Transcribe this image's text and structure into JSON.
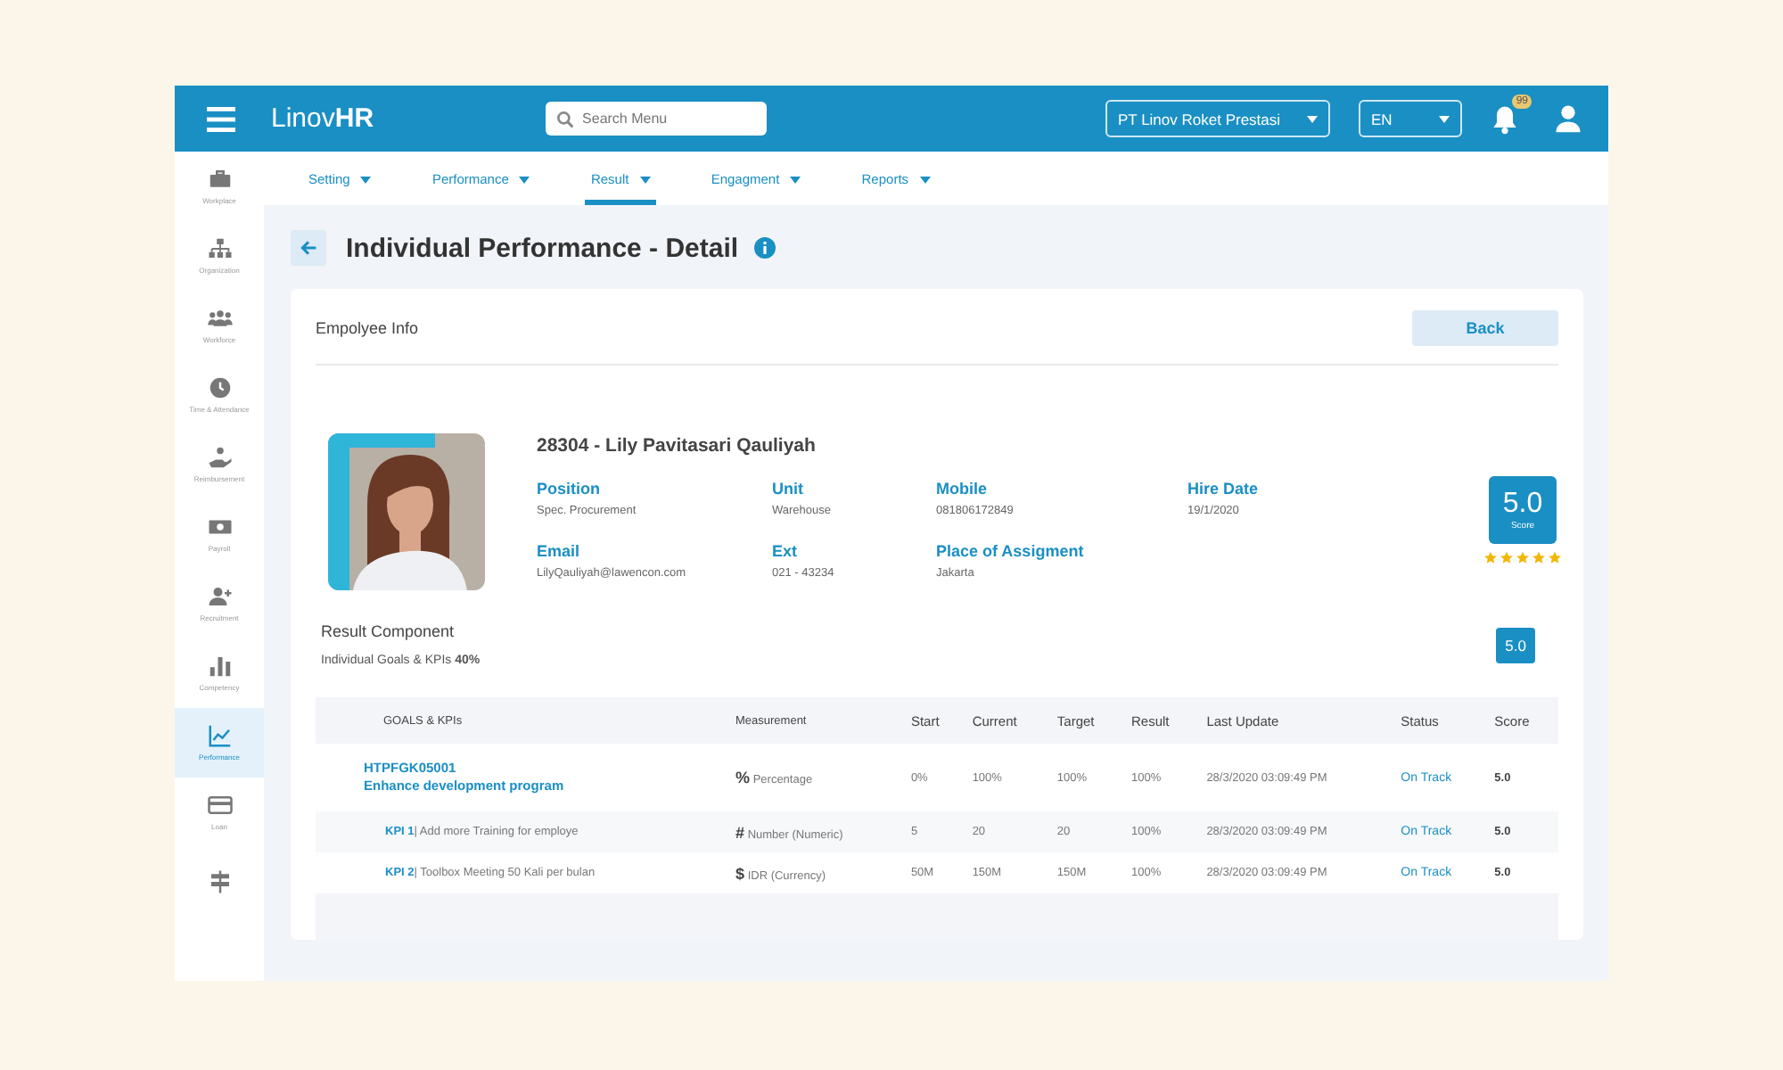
{
  "topbar": {
    "logo": "Linov**HR**",
    "search": {
      "placeholder": "Search Menu"
    },
    "company": "PT Linov Roket Prestasi",
    "language": "EN",
    "notification_count": "99"
  },
  "nav_tabs": [
    {
      "label": "Setting",
      "selected": false
    },
    {
      "label": "Performance",
      "selected": false
    },
    {
      "label": "Result",
      "selected": true
    },
    {
      "label": "Engagment",
      "selected": false
    },
    {
      "label": "Reports",
      "selected": false
    }
  ],
  "sidebar": {
    "items": [
      {
        "label": "Workplace",
        "selected": false
      },
      {
        "label": "Organization",
        "selected": false
      },
      {
        "label": "Workforce",
        "selected": false
      },
      {
        "label": "Time & Attendance",
        "selected": false
      },
      {
        "label": "Reimbursement",
        "selected": false
      },
      {
        "label": "Payroll",
        "selected": false
      },
      {
        "label": "Recruitment",
        "selected": false
      },
      {
        "label": "Competency",
        "selected": false
      },
      {
        "label": "Performance",
        "selected": true
      },
      {
        "label": "Loan",
        "selected": false
      },
      {
        "selected": false
      }
    ]
  },
  "page_title": "Individual Performance - Detail",
  "card": {
    "title": "Empolyee Info",
    "back_button": "Back",
    "employee": {
      "name": "28304 - Lily Pavitasari Qauliyah",
      "fields": [
        {
          "label": "Position",
          "value": "Spec. Procurement"
        },
        {
          "label": "Unit",
          "value": "Warehouse"
        },
        {
          "label": "Mobile",
          "value": "081806172849"
        },
        {
          "label": "Hire Date",
          "value": "19/1/2020"
        },
        {
          "label": "Email",
          "value": "LilyQauliyah@lawencon.com"
        },
        {
          "label": "Ext",
          "value": "021 - 43234"
        },
        {
          "label": "Place of Assigment",
          "value": "Jakarta"
        }
      ],
      "score": "5.0",
      "score_label": "Score",
      "stars": 5
    },
    "result_component": {
      "title": "Result Component",
      "subtitle": "Individual Goals & KPIs **40%**",
      "score": "5.0"
    },
    "table": {
      "columns": [
        "GOALS & KPIs",
        "Measurement",
        "Start",
        "Current",
        "Target",
        "Result",
        "Last Update",
        "Status",
        "Score"
      ],
      "rows": [
        {
          "kind": "goal",
          "code": "HTPFGK05001",
          "name": "Enhance development program",
          "measure_icon": "%",
          "measurement": "Percentage",
          "start": "0%",
          "current": "100%",
          "target": "100%",
          "result": "100%",
          "last_update": "28/3/2020 03:09:49 PM",
          "status": "On Track",
          "score": "5.0"
        },
        {
          "kind": "kpi",
          "code": "KPI 1",
          "name": "| Add more Training for employe",
          "measure_icon": "#",
          "measurement": "Number (Numeric)",
          "start": "5",
          "current": "20",
          "target": "20",
          "result": "100%",
          "last_update": "28/3/2020 03:09:49 PM",
          "status": "On Track",
          "score": "5.0"
        },
        {
          "kind": "kpi",
          "code": "KPI 2",
          "name": "| Toolbox Meeting 50 Kali per bulan",
          "measure_icon": "$",
          "measurement": "IDR (Currency)",
          "start": "50M",
          "current": "150M",
          "target": "150M",
          "result": "100%",
          "last_update": "28/3/2020 03:09:49 PM",
          "status": "On Track",
          "score": "5.0"
        }
      ]
    }
  }
}
